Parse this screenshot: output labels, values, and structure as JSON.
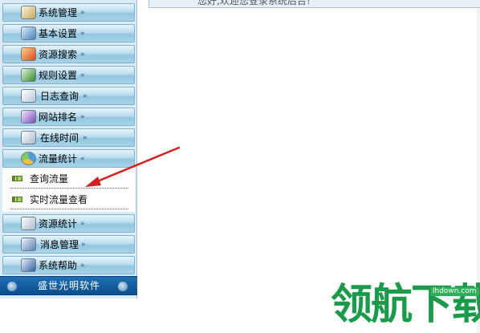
{
  "sidebar": {
    "items": [
      {
        "label": "系统管理",
        "chevron": "»"
      },
      {
        "label": "基本设置",
        "chevron": "»"
      },
      {
        "label": "资源搜索",
        "chevron": "»"
      },
      {
        "label": "规则设置",
        "chevron": "»"
      },
      {
        "label": "日志查询",
        "chevron": "»"
      },
      {
        "label": "网站排名",
        "chevron": "»"
      },
      {
        "label": "在线时间",
        "chevron": "»"
      },
      {
        "label": "流量统计",
        "chevron": "«"
      },
      {
        "label": "资源统计",
        "chevron": "»"
      },
      {
        "label": "消息管理",
        "chevron": "»"
      },
      {
        "label": "系统帮助",
        "chevron": "»"
      }
    ],
    "submenu": [
      {
        "label": "查询流量"
      },
      {
        "label": "实时流量查看"
      }
    ],
    "footer_label": "盛世光明软件"
  },
  "content": {
    "top_text": "您好,欢迎您登录系统后台!"
  },
  "watermark": {
    "text": "领航下载",
    "url": "lhdown.com"
  },
  "colors": {
    "sidebar_bg": "#dcecf7",
    "footer_bar": "#0b4f8e",
    "arrow": "#d62020",
    "watermark": "#1a9a4a"
  }
}
